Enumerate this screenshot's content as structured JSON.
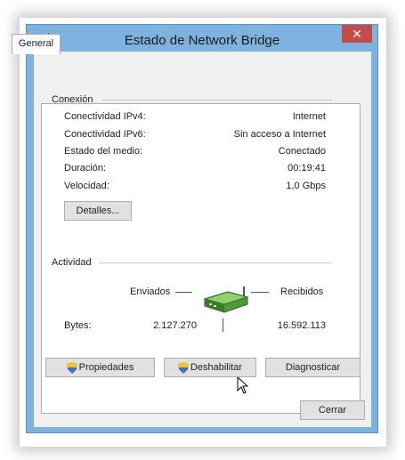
{
  "window": {
    "title": "Estado de Network Bridge",
    "close_glyph": "✕",
    "title_icon": "network-icon"
  },
  "tabs": [
    {
      "label": "General"
    }
  ],
  "connection": {
    "group_title": "Conexión",
    "rows": [
      {
        "label": "Conectividad IPv4:",
        "value": "Internet"
      },
      {
        "label": "Conectividad IPv6:",
        "value": "Sin acceso a Internet"
      },
      {
        "label": "Estado del medio:",
        "value": "Conectado"
      },
      {
        "label": "Duración:",
        "value": "00:19:41"
      },
      {
        "label": "Velocidad:",
        "value": "1,0 Gbps"
      }
    ],
    "details_label": "Detalles..."
  },
  "activity": {
    "group_title": "Actividad",
    "sent_label": "Enviados",
    "received_label": "Recibidos",
    "bytes_label": "Bytes:",
    "bytes_sent": "2.127.270",
    "bytes_received": "16.592.113",
    "device_icon": "network-adapter-icon"
  },
  "buttons": {
    "properties": "Propiedades",
    "disable": "Deshabilitar",
    "diagnose": "Diagnosticar",
    "close": "Cerrar"
  },
  "colors": {
    "title_bar": "#7eb3df",
    "close_button": "#c74a4a",
    "adapter_green": "#4f9a3c"
  }
}
